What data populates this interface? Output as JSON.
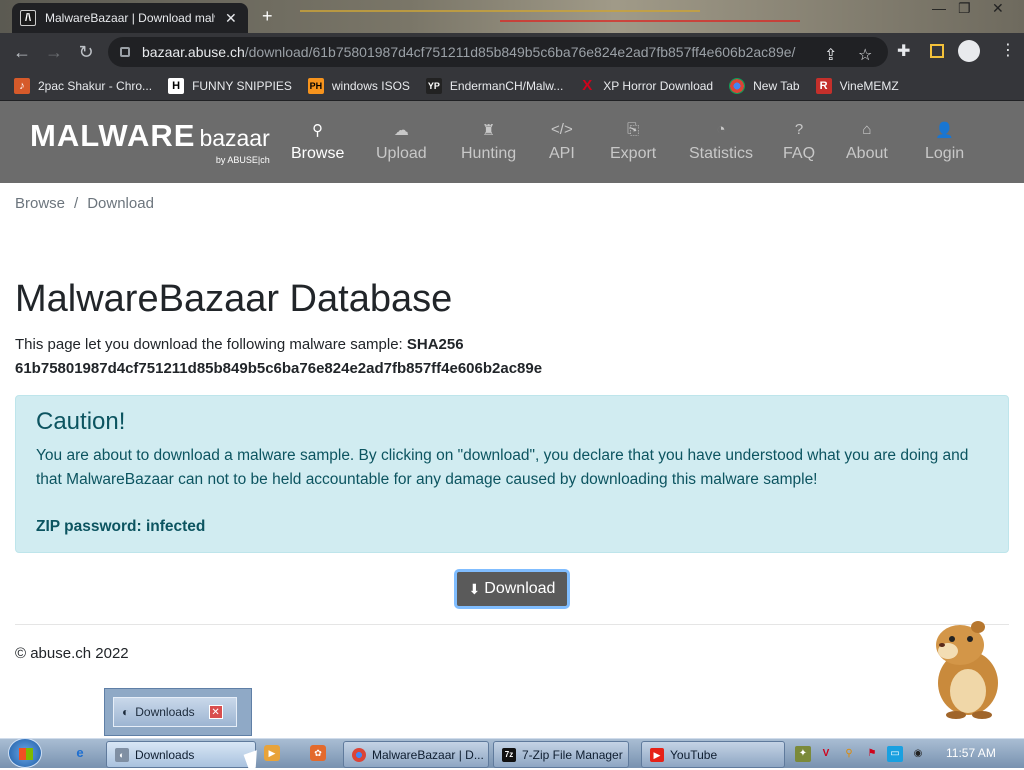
{
  "browser": {
    "tab_title": "MalwareBazaar | Download malw",
    "tab_close": "✕",
    "new_tab": "+",
    "url_host": "bazaar.abuse.ch",
    "url_path": "/download/61b75801987d4cf751211d85b849b5c6ba76e824e2ad7fb857ff4e606b2ac89e/",
    "bookmarks": [
      {
        "label": "2pac Shakur - Chro...",
        "icon": "music-icon",
        "color": "#d65a2a"
      },
      {
        "label": "FUNNY SNIPPIES",
        "icon": "H",
        "color": "#1b1b1b"
      },
      {
        "label": "windows ISOS",
        "icon": "PH",
        "color": "#f7941d"
      },
      {
        "label": "EndermanCH/Malw...",
        "icon": "YP",
        "color": "#222"
      },
      {
        "label": "XP Horror Download",
        "icon": "X",
        "color": "#d0021b"
      },
      {
        "label": "New Tab",
        "icon": "chrome-icon",
        "color": "#6aa84f"
      },
      {
        "label": "VineMEMZ",
        "icon": "R",
        "color": "#c4302b"
      }
    ]
  },
  "site": {
    "logo_main": "MALWARE",
    "logo_sub": "bazaar",
    "logo_by": "by ABUSE|ch",
    "nav": [
      {
        "label": "Browse",
        "icon": "search-icon",
        "glyph": "⚲",
        "active": true
      },
      {
        "label": "Upload",
        "icon": "cloud-upload-icon",
        "glyph": "☁",
        "active": false
      },
      {
        "label": "Hunting",
        "icon": "binoculars-icon",
        "glyph": "♜",
        "active": false
      },
      {
        "label": "API",
        "icon": "code-icon",
        "glyph": "</>",
        "active": false
      },
      {
        "label": "Export",
        "icon": "export-icon",
        "glyph": "⎘",
        "active": false
      },
      {
        "label": "Statistics",
        "icon": "pie-chart-icon",
        "glyph": "◔",
        "active": false
      },
      {
        "label": "FAQ",
        "icon": "question-icon",
        "glyph": "?",
        "active": false
      },
      {
        "label": "About",
        "icon": "building-icon",
        "glyph": "⌂",
        "active": false
      },
      {
        "label": "Login",
        "icon": "user-icon",
        "glyph": "👤",
        "active": false
      }
    ]
  },
  "breadcrumb": {
    "root": "Browse",
    "sep": "/",
    "current": "Download"
  },
  "page": {
    "title": "MalwareBazaar Database",
    "intro_text": "This page let you download the following malware sample: ",
    "intro_hash_label": "SHA256",
    "hash": "61b75801987d4cf751211d85b849b5c6ba76e824e2ad7fb857ff4e606b2ac89e",
    "alert_title": "Caution!",
    "alert_text": "You are about to download a malware sample. By clicking on \"download\", you declare that you have understood what you are doing and that MalwareBazaar can not to be held accountable for any damage caused by downloading this malware sample!",
    "zip_password": "ZIP password: infected",
    "download_label": "Download",
    "footer": "© abuse.ch 2022"
  },
  "taskbar": {
    "popup_label": "Downloads",
    "items": [
      {
        "label": "Downloads",
        "icon": "folder-icon"
      },
      {
        "label": "MalwareBazaar | D...",
        "icon": "chrome-icon"
      },
      {
        "label": "7-Zip File Manager",
        "icon": "7zip-icon"
      },
      {
        "label": "YouTube",
        "icon": "youtube-icon"
      }
    ],
    "clock": "11:57 AM"
  },
  "colors": {
    "nav_bg": "#6c6c6c",
    "alert_bg": "#d1ecf1",
    "alert_text": "#0c5460",
    "button_bg": "#5a5a5a"
  }
}
